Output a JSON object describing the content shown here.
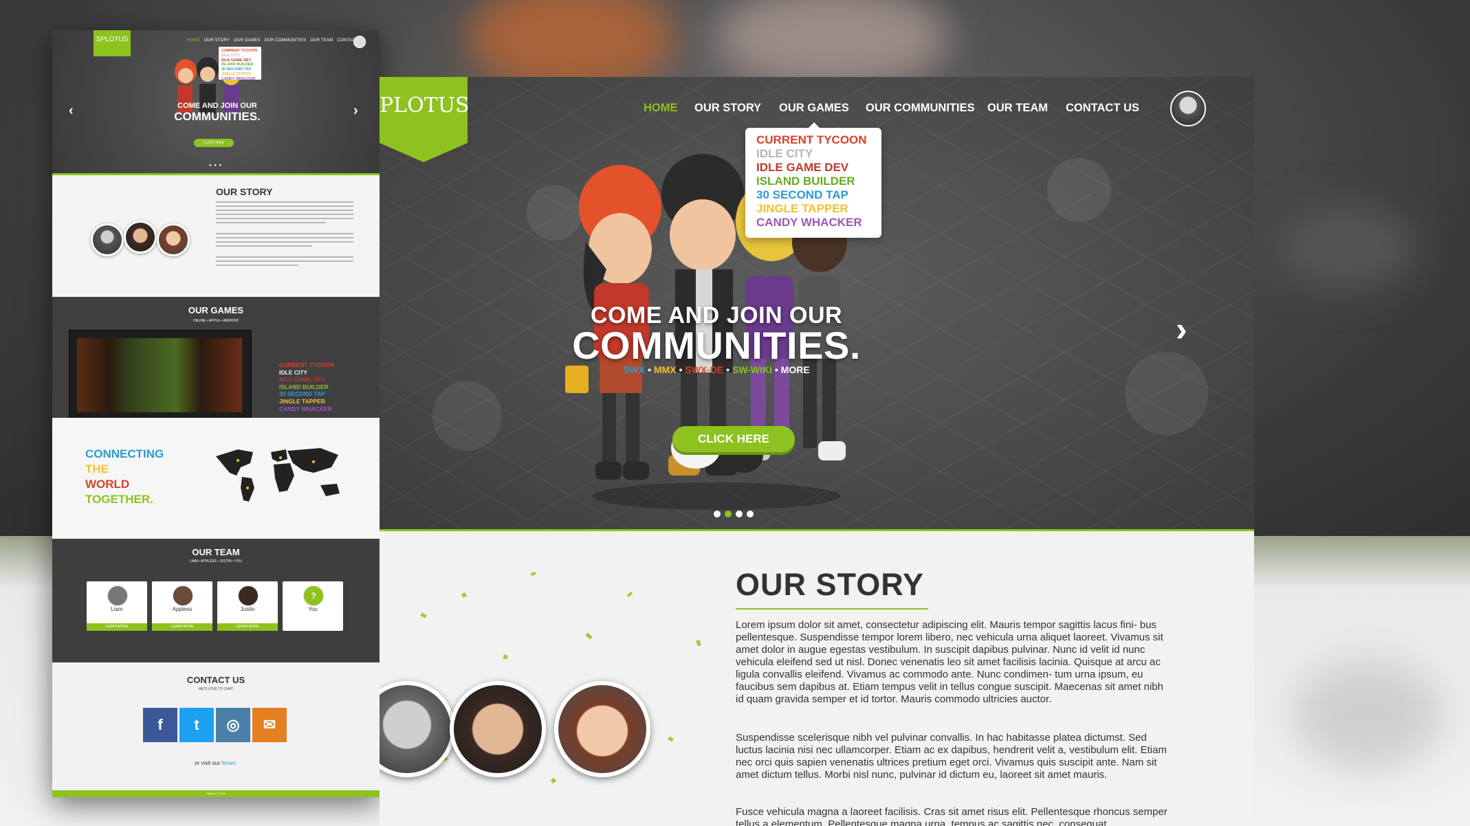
{
  "colors": {
    "accent": "#8dc21f",
    "dark": "#3e3e3e",
    "light": "#f2f2f2",
    "text": "#333333"
  },
  "preview": {
    "logo": "SPLOTUS",
    "nav": [
      "HOME",
      "OUR STORY",
      "OUR GAMES",
      "OUR COMMUNITIES",
      "OUR TEAM",
      "CONTACT US"
    ],
    "menu": [
      "CURRENT TYCOON",
      "IDLE CITY",
      "IDLE GAME DEV",
      "ISLAND BUILDER",
      "30 SECOND TAP",
      "JINGLE TAPPER",
      "CANDY WHACKER"
    ],
    "headline1": "COME AND JOIN OUR",
    "headline2": "COMMUNITIES.",
    "cta": "CLICK HERE",
    "story_title": "OUR STORY",
    "games_title": "OUR GAMES",
    "games_sub": "ONLINE • APPLE • ANDROID",
    "games": [
      "CURRENT TYCOON",
      "IDLE CITY",
      "IDLE GAME DEV",
      "ISLAND BUILDER",
      "30 SECOND TAP",
      "JINGLE TAPPER",
      "CANDY WHACKER"
    ],
    "connect": [
      "CONNECTING",
      "THE",
      "WORLD",
      "TOGETHER."
    ],
    "team_title": "OUR TEAM",
    "team_sub": "LIAM • APPLESS • JUSTIN • YOU",
    "team": [
      {
        "name": "Liam",
        "btn": "LEARN MORE"
      },
      {
        "name": "Appless",
        "btn": "LEARN MORE"
      },
      {
        "name": "Justin",
        "btn": "LEARN MORE"
      },
      {
        "name": "You",
        "btn": ""
      }
    ],
    "you_icon": "?",
    "contact_title": "CONTACT US",
    "contact_sub": "WE'D LOVE TO CHAT.",
    "social": [
      {
        "icon": "facebook-icon",
        "glyph": "f",
        "color": "#3b5998"
      },
      {
        "icon": "twitter-icon",
        "glyph": "t",
        "color": "#1da1f2"
      },
      {
        "icon": "instagram-icon",
        "glyph": "◎",
        "color": "#4a7fa7"
      },
      {
        "icon": "mail-icon",
        "glyph": "✉",
        "color": "#e67e22"
      }
    ],
    "forum_prefix": "or visit our",
    "forum_link": "forum.",
    "footer": "Splotus © 2016",
    "arrow_left": "‹",
    "arrow_right": "›"
  },
  "main": {
    "logo": "PLOTUS",
    "nav": [
      "HOME",
      "OUR STORY",
      "OUR GAMES",
      "OUR COMMUNITIES",
      "OUR TEAM",
      "CONTACT US"
    ],
    "dropdown": [
      {
        "label": "CURRENT TYCOON",
        "color": "#d9412b"
      },
      {
        "label": "IDLE CITY",
        "color": "#b5b5b5"
      },
      {
        "label": "IDLE GAME DEV",
        "color": "#c0392b"
      },
      {
        "label": "ISLAND BUILDER",
        "color": "#6aa820"
      },
      {
        "label": "30 SECOND TAP",
        "color": "#2b9ad6"
      },
      {
        "label": "JINGLE TAPPER",
        "color": "#f2c12e"
      },
      {
        "label": "CANDY WHACKER",
        "color": "#9b59b6"
      }
    ],
    "headline1": "COME AND JOIN OUR",
    "headline2": "COMMUNITIES.",
    "communities": [
      {
        "label": "SWX",
        "color": "#2b9ad6"
      },
      {
        "label": "MMX",
        "color": "#f2c12e"
      },
      {
        "label": "SWX-DE",
        "color": "#d9412b"
      },
      {
        "label": "SW-WIKI",
        "color": "#8dc21f"
      },
      {
        "label": "MORE",
        "color": "#ffffff"
      }
    ],
    "separator": "•",
    "cta": "CLICK HERE",
    "arrow_right": "›",
    "story_title": "OUR STORY",
    "story_p1": "Lorem ipsum dolor sit amet, consectetur adipiscing elit. Mauris tempor sagittis lacus fini- bus pellentesque. Suspendisse tempor lorem libero, nec vehicula urna aliquet laoreet. Vivamus sit amet dolor in augue egestas vestibulum. In suscipit dapibus pulvinar. Nunc id velit id nunc vehicula eleifend sed ut nisl. Donec venenatis leo sit amet facilisis lacinia. Quisque at arcu ac ligula convallis eleifend. Vivamus ac commodo ante. Nunc condimen- tum urna ipsum, eu faucibus sem dapibus at. Etiam tempus velit in tellus congue suscipit. Maecenas sit amet nibh id quam gravida semper et id tortor. Mauris commodo ultricies auctor.",
    "story_p2": "Suspendisse scelerisque nibh vel pulvinar convallis. In hac habitasse platea dictumst. Sed luctus lacinia nisi nec ullamcorper. Etiam ac ex dapibus, hendrerit velit a, vestibulum elit. Etiam nec orci quis sapien venenatis ultrices pretium eget orci. Vivamus quis suscipit ante. Nam sit amet dictum tellus. Morbi nisl nunc, pulvinar id dictum eu, laoreet sit amet mauris.",
    "story_p3": "Fusce vehicula magna a laoreet facilisis. Cras sit amet risus elit. Pellentesque rhoncus semper tellus a elementum. Pellentesque magna urna, tempus ac sagittis nec, consequat"
  }
}
